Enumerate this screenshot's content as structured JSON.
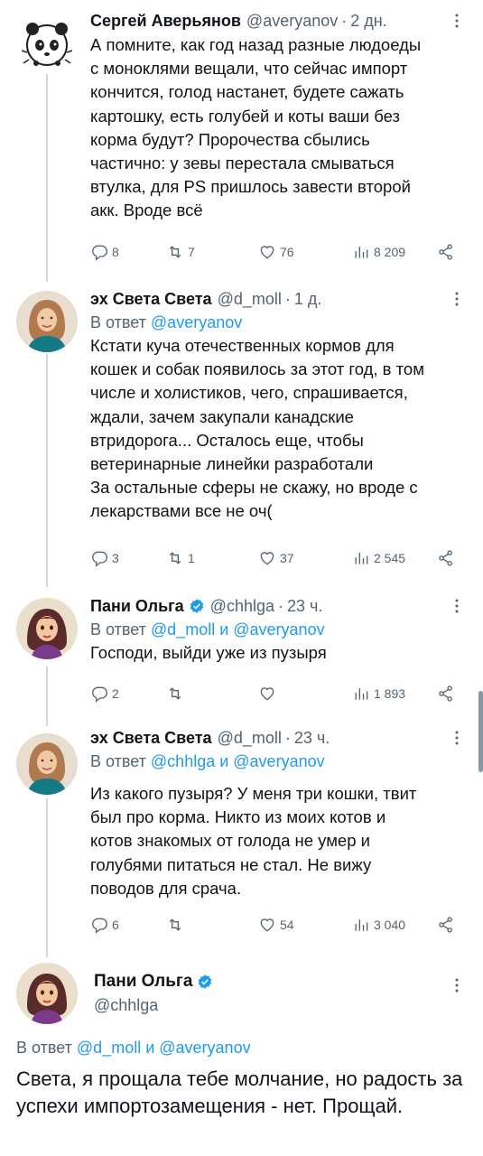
{
  "tweets": [
    {
      "name": "Сергей Аверьянов",
      "handle": "@averyanov",
      "time": "2 дн.",
      "reply_to_label": "",
      "reply_to_users": "",
      "text": "А помните, как год назад разные людоеды\nс моноклями вещали, что сейчас импорт\nкончится, голод настанет, будете сажать\nкартошку, есть голубей и коты ваши без\nкорма будут? Пророчества сбылись\nчастично: у зевы перестала смываться\nвтулка, для PS пришлось завести второй\nакк. Вроде всё",
      "replies": "8",
      "retweets": "7",
      "likes": "76",
      "views": "8 209",
      "avatar_icon": "panda-avatar-icon"
    },
    {
      "name": "эх Света Света",
      "handle": "@d_moll",
      "time": "1 д.",
      "reply_to_label": "В ответ",
      "reply_to_users": "@averyanov",
      "text": "Кстати куча отечественных кормов для\nкошек и собак появилось за этот год, в том\nчисле и холистиков, чего, спрашивается,\nждали, зачем закупали канадские\nвтридорога... Осталось еще, чтобы\nветеринарные линейки разработали\nЗа остальные сферы не скажу, но вроде с\nлекарствами все не оч(",
      "replies": "3",
      "retweets": "1",
      "likes": "37",
      "views": "2 545"
    },
    {
      "name": "Пани Ольга",
      "handle": "@chhlga",
      "time": "23 ч.",
      "reply_to_label": "В ответ",
      "reply_to_users": "@d_moll и @averyanov",
      "text": "Господи, выйди уже из пузыря",
      "replies": "2",
      "retweets": "",
      "likes": "",
      "views": "1 893"
    },
    {
      "name": "эх Света Света",
      "handle": "@d_moll",
      "time": "23 ч.",
      "reply_to_label": "В ответ",
      "reply_to_users": "@chhlga и @averyanov",
      "text": "Из какого пузыря? У меня три кошки, твит\nбыл про корма. Никто из моих котов и\nкотов знакомых от голода не умер и\nголубями питаться не стал. Не вижу\nповодов для срача.",
      "replies": "6",
      "retweets": "",
      "likes": "54",
      "views": "3 040"
    }
  ],
  "main_tweet": {
    "name": "Пани Ольга",
    "handle": "@chhlga",
    "reply_to_label": "В ответ",
    "reply_to_users": "@d_moll и @averyanov",
    "text": "Света, я прощала тебе молчание, но радость за успехи импортозамещения - нет. Прощай."
  },
  "colors": {
    "accent": "#1d9bf0",
    "secondary_text": "#536471",
    "thread_line": "#cfd9de"
  }
}
